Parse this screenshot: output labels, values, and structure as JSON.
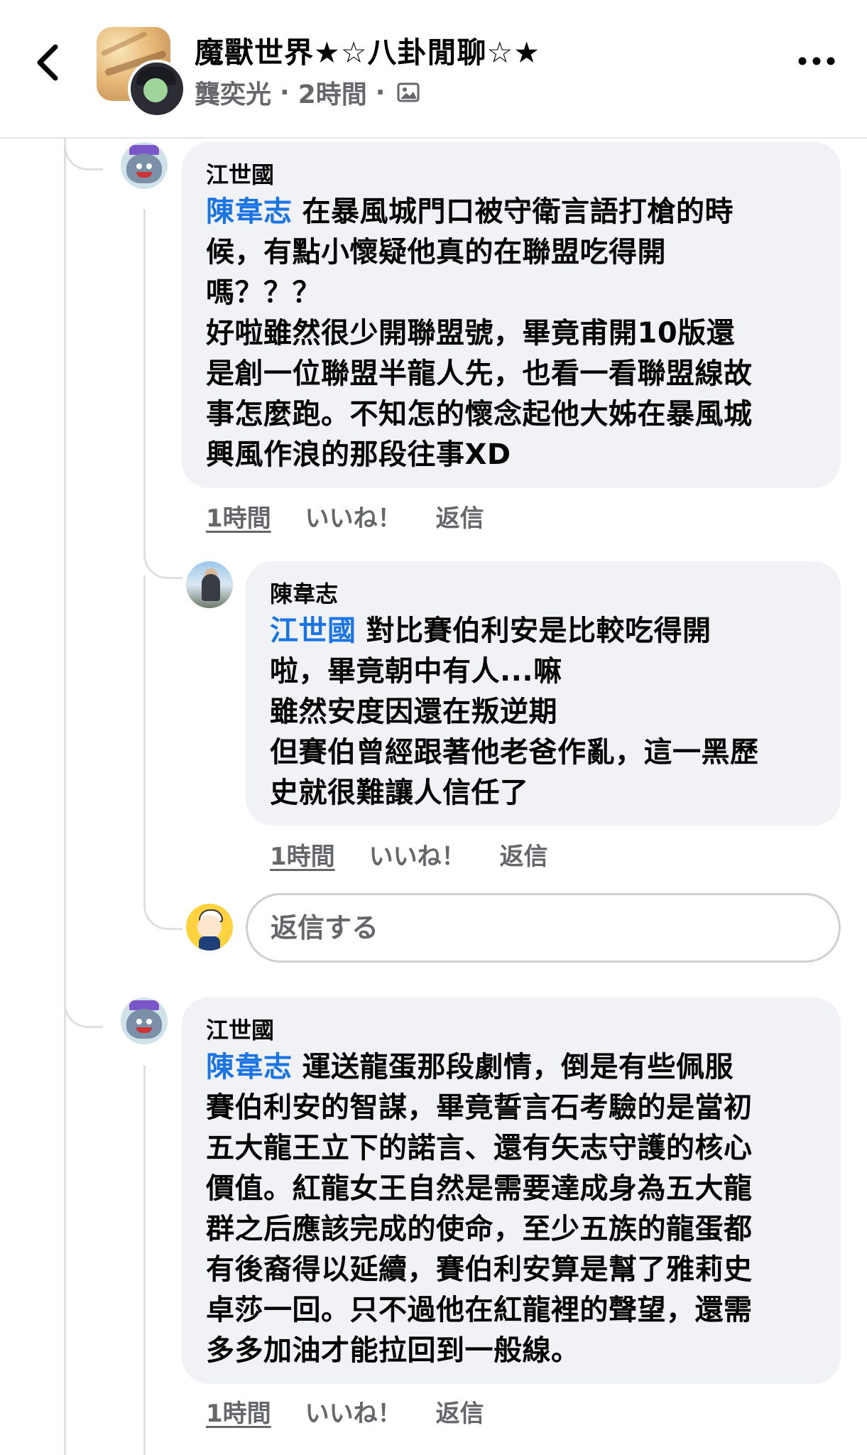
{
  "header": {
    "group_title": "魔獸世界★☆八卦閒聊☆★",
    "author": "龔奕光",
    "separator": "·",
    "time": "2時間",
    "back_icon": "chevron-left-icon",
    "more_icon": "more-horizontal-icon",
    "audience_icon": "photo-icon"
  },
  "comments": [
    {
      "author": "江世國",
      "mention": "陳韋志",
      "lines": [
        "在暴風城門口被守衛言語打槍的時",
        "候，有點小懷疑他真的在聯盟吃得開",
        "嗎？？？",
        "好啦雖然很少開聯盟號，畢竟甫開10版還",
        "是創一位聯盟半龍人先，也看一看聯盟線故",
        "事怎麼跑。不知怎的懷念起他大姊在暴風城",
        "興風作浪的那段往事XD"
      ],
      "time": "1時間",
      "like": "いいね！",
      "reply": "返信"
    },
    {
      "author": "陳韋志",
      "mention": "江世國",
      "lines": [
        "對比賽伯利安是比較吃得開",
        "啦，畢竟朝中有人...嘛",
        "雖然安度因還在叛逆期",
        "但賽伯曾經跟著他老爸作亂，這一黑歷",
        "史就很難讓人信任了"
      ],
      "time": "1時間",
      "like": "いいね！",
      "reply": "返信"
    },
    {
      "author": "江世國",
      "mention": "陳韋志",
      "lines": [
        "運送龍蛋那段劇情，倒是有些佩服",
        "賽伯利安的智謀，畢竟誓言石考驗的是當初",
        "五大龍王立下的諾言、還有矢志守護的核心",
        "價值。紅龍女王自然是需要達成身為五大龍",
        "群之后應該完成的使命，至少五族的龍蛋都",
        "有後裔得以延續，賽伯利安算是幫了雅莉史",
        "卓莎一回。只不過他在紅龍裡的聲望，還需",
        "多多加油才能拉回到一般線。"
      ],
      "time": "1時間",
      "like": "いいね！",
      "reply": "返信"
    }
  ],
  "reply_box": {
    "placeholder": "返信する"
  }
}
